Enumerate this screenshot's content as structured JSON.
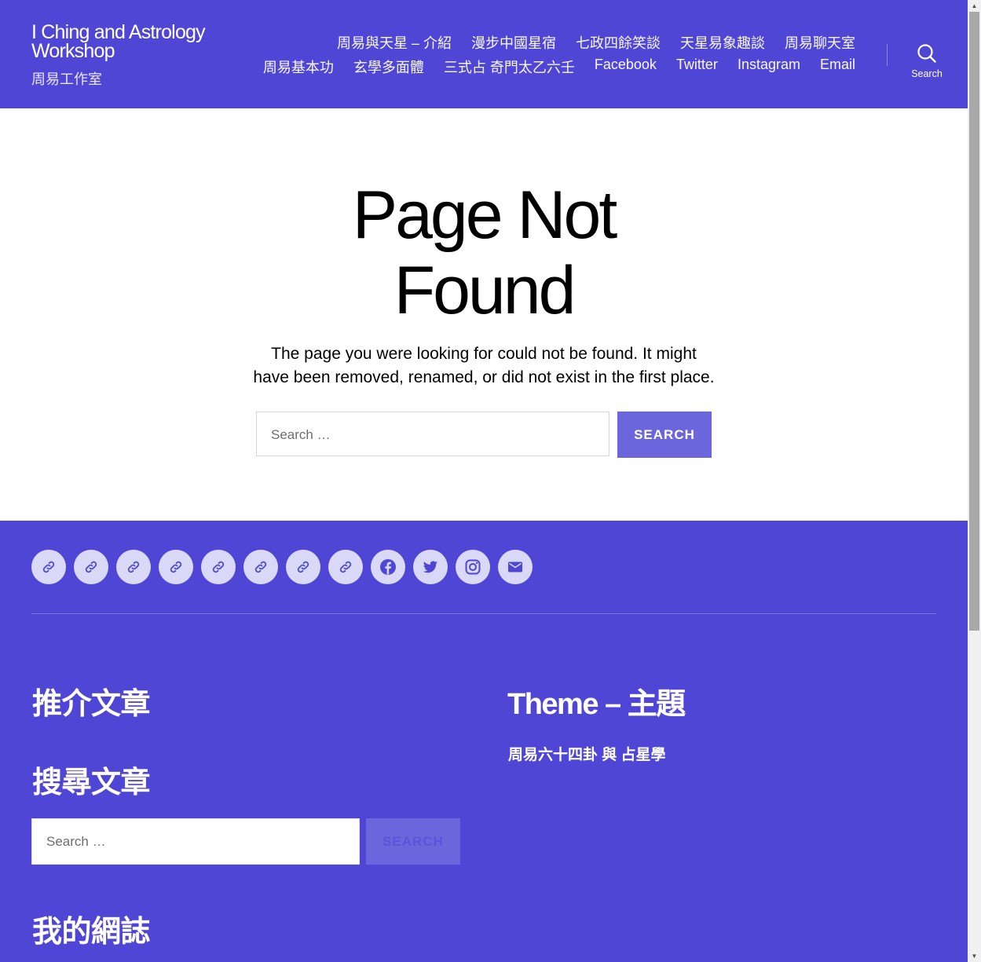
{
  "header": {
    "site_title": "I Ching and Astrology Workshop",
    "site_description": "周易工作室",
    "nav_row1": [
      "周易與天星 – 介紹",
      "漫步中國星宿",
      "七政四餘笑談",
      "天星易象趣談",
      "周易聊天室"
    ],
    "nav_row2": [
      "周易基本功",
      "玄學多面體",
      "三式占 奇門太乙六壬",
      "Facebook",
      "Twitter",
      "Instagram",
      "Email"
    ],
    "search_label": "Search"
  },
  "main": {
    "title_line1": "Page Not",
    "title_line2": "Found",
    "text_line1": "The page you were looking for could not be found. It might",
    "text_line2": "have been removed, renamed, or did not exist in the first place.",
    "search_placeholder": "Search …",
    "search_button": "SEARCH"
  },
  "footer": {
    "social_icons": [
      "link-icon",
      "link-icon",
      "link-icon",
      "link-icon",
      "link-icon",
      "link-icon",
      "link-icon",
      "link-icon",
      "facebook-icon",
      "twitter-icon",
      "instagram-icon",
      "email-icon"
    ],
    "featured_heading": "推介文章",
    "search_heading": "搜尋文章",
    "search_placeholder": "Search …",
    "search_button": "SEARCH",
    "blog_heading": "我的網誌",
    "theme_heading": "Theme – 主題",
    "theme_text": "周易六十四卦 與 占星學"
  },
  "colors": {
    "brand": "#5046d5",
    "button": "#6b66dc",
    "icon_circle": "#d9d8f6"
  }
}
